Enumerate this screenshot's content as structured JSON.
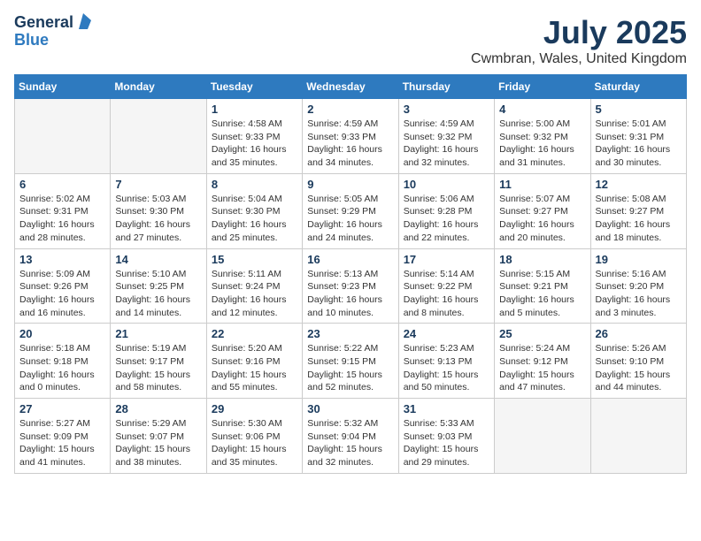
{
  "logo": {
    "general": "General",
    "blue": "Blue"
  },
  "title": "July 2025",
  "subtitle": "Cwmbran, Wales, United Kingdom",
  "days_header": [
    "Sunday",
    "Monday",
    "Tuesday",
    "Wednesday",
    "Thursday",
    "Friday",
    "Saturday"
  ],
  "weeks": [
    [
      {
        "num": "",
        "info": ""
      },
      {
        "num": "",
        "info": ""
      },
      {
        "num": "1",
        "info": "Sunrise: 4:58 AM\nSunset: 9:33 PM\nDaylight: 16 hours\nand 35 minutes."
      },
      {
        "num": "2",
        "info": "Sunrise: 4:59 AM\nSunset: 9:33 PM\nDaylight: 16 hours\nand 34 minutes."
      },
      {
        "num": "3",
        "info": "Sunrise: 4:59 AM\nSunset: 9:32 PM\nDaylight: 16 hours\nand 32 minutes."
      },
      {
        "num": "4",
        "info": "Sunrise: 5:00 AM\nSunset: 9:32 PM\nDaylight: 16 hours\nand 31 minutes."
      },
      {
        "num": "5",
        "info": "Sunrise: 5:01 AM\nSunset: 9:31 PM\nDaylight: 16 hours\nand 30 minutes."
      }
    ],
    [
      {
        "num": "6",
        "info": "Sunrise: 5:02 AM\nSunset: 9:31 PM\nDaylight: 16 hours\nand 28 minutes."
      },
      {
        "num": "7",
        "info": "Sunrise: 5:03 AM\nSunset: 9:30 PM\nDaylight: 16 hours\nand 27 minutes."
      },
      {
        "num": "8",
        "info": "Sunrise: 5:04 AM\nSunset: 9:30 PM\nDaylight: 16 hours\nand 25 minutes."
      },
      {
        "num": "9",
        "info": "Sunrise: 5:05 AM\nSunset: 9:29 PM\nDaylight: 16 hours\nand 24 minutes."
      },
      {
        "num": "10",
        "info": "Sunrise: 5:06 AM\nSunset: 9:28 PM\nDaylight: 16 hours\nand 22 minutes."
      },
      {
        "num": "11",
        "info": "Sunrise: 5:07 AM\nSunset: 9:27 PM\nDaylight: 16 hours\nand 20 minutes."
      },
      {
        "num": "12",
        "info": "Sunrise: 5:08 AM\nSunset: 9:27 PM\nDaylight: 16 hours\nand 18 minutes."
      }
    ],
    [
      {
        "num": "13",
        "info": "Sunrise: 5:09 AM\nSunset: 9:26 PM\nDaylight: 16 hours\nand 16 minutes."
      },
      {
        "num": "14",
        "info": "Sunrise: 5:10 AM\nSunset: 9:25 PM\nDaylight: 16 hours\nand 14 minutes."
      },
      {
        "num": "15",
        "info": "Sunrise: 5:11 AM\nSunset: 9:24 PM\nDaylight: 16 hours\nand 12 minutes."
      },
      {
        "num": "16",
        "info": "Sunrise: 5:13 AM\nSunset: 9:23 PM\nDaylight: 16 hours\nand 10 minutes."
      },
      {
        "num": "17",
        "info": "Sunrise: 5:14 AM\nSunset: 9:22 PM\nDaylight: 16 hours\nand 8 minutes."
      },
      {
        "num": "18",
        "info": "Sunrise: 5:15 AM\nSunset: 9:21 PM\nDaylight: 16 hours\nand 5 minutes."
      },
      {
        "num": "19",
        "info": "Sunrise: 5:16 AM\nSunset: 9:20 PM\nDaylight: 16 hours\nand 3 minutes."
      }
    ],
    [
      {
        "num": "20",
        "info": "Sunrise: 5:18 AM\nSunset: 9:18 PM\nDaylight: 16 hours\nand 0 minutes."
      },
      {
        "num": "21",
        "info": "Sunrise: 5:19 AM\nSunset: 9:17 PM\nDaylight: 15 hours\nand 58 minutes."
      },
      {
        "num": "22",
        "info": "Sunrise: 5:20 AM\nSunset: 9:16 PM\nDaylight: 15 hours\nand 55 minutes."
      },
      {
        "num": "23",
        "info": "Sunrise: 5:22 AM\nSunset: 9:15 PM\nDaylight: 15 hours\nand 52 minutes."
      },
      {
        "num": "24",
        "info": "Sunrise: 5:23 AM\nSunset: 9:13 PM\nDaylight: 15 hours\nand 50 minutes."
      },
      {
        "num": "25",
        "info": "Sunrise: 5:24 AM\nSunset: 9:12 PM\nDaylight: 15 hours\nand 47 minutes."
      },
      {
        "num": "26",
        "info": "Sunrise: 5:26 AM\nSunset: 9:10 PM\nDaylight: 15 hours\nand 44 minutes."
      }
    ],
    [
      {
        "num": "27",
        "info": "Sunrise: 5:27 AM\nSunset: 9:09 PM\nDaylight: 15 hours\nand 41 minutes."
      },
      {
        "num": "28",
        "info": "Sunrise: 5:29 AM\nSunset: 9:07 PM\nDaylight: 15 hours\nand 38 minutes."
      },
      {
        "num": "29",
        "info": "Sunrise: 5:30 AM\nSunset: 9:06 PM\nDaylight: 15 hours\nand 35 minutes."
      },
      {
        "num": "30",
        "info": "Sunrise: 5:32 AM\nSunset: 9:04 PM\nDaylight: 15 hours\nand 32 minutes."
      },
      {
        "num": "31",
        "info": "Sunrise: 5:33 AM\nSunset: 9:03 PM\nDaylight: 15 hours\nand 29 minutes."
      },
      {
        "num": "",
        "info": ""
      },
      {
        "num": "",
        "info": ""
      }
    ]
  ]
}
